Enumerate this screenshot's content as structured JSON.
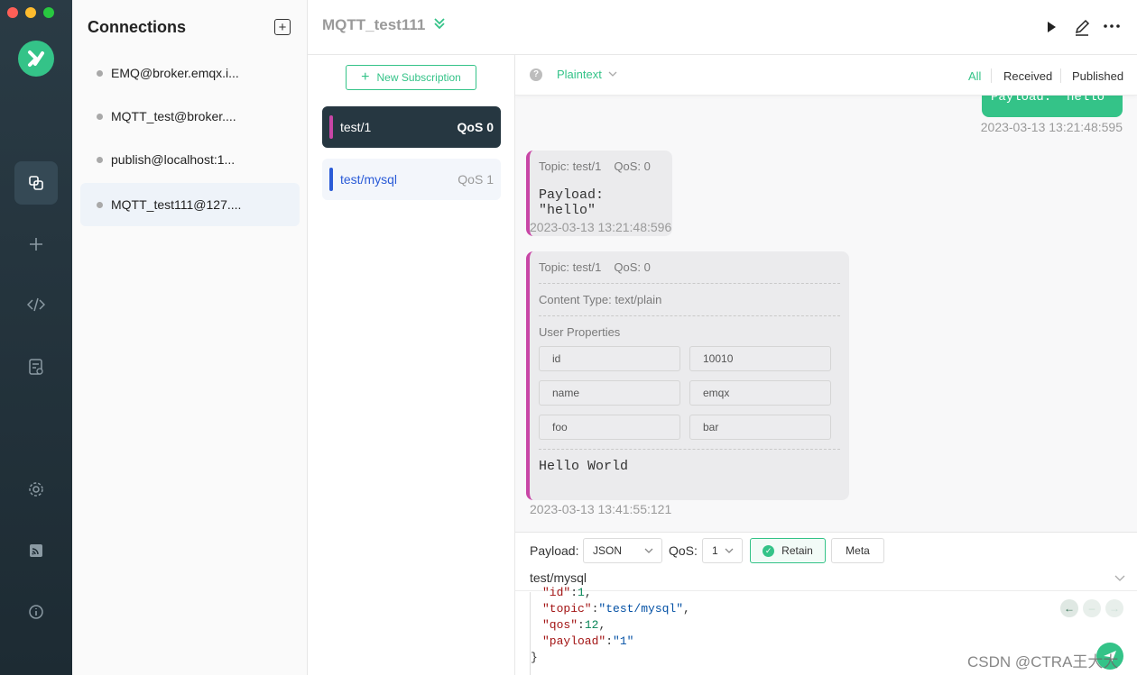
{
  "connections": {
    "title": "Connections",
    "add_icon": "plus-square-icon",
    "items": [
      {
        "label": "EMQ@broker.emqx.i..."
      },
      {
        "label": "MQTT_test@broker...."
      },
      {
        "label": "publish@localhost:1..."
      },
      {
        "label": "MQTT_test111@127...."
      }
    ]
  },
  "rail": {
    "icons": [
      "connections-icon",
      "plus-icon",
      "script-icon",
      "log-icon",
      "settings-icon",
      "rss-icon",
      "info-icon"
    ]
  },
  "header": {
    "title": "MQTT_test111",
    "icons": [
      "double-chevron-down-icon",
      "play-icon",
      "edit-icon",
      "more-icon"
    ]
  },
  "subscriptions": {
    "new_label": "New Subscription",
    "items": [
      {
        "topic": "test/1",
        "qos": "QoS 0",
        "color": "#c846a6"
      },
      {
        "topic": "test/mysql",
        "qos": "QoS 1",
        "color": "#2a5bd7"
      }
    ]
  },
  "filter": {
    "format": "Plaintext",
    "tabs": [
      "All",
      "Received",
      "Published"
    ],
    "active_tab": "All"
  },
  "messages": {
    "published": {
      "payload": "Payload: \"hello\"",
      "time": "2023-03-13 13:21:48:595"
    },
    "received": [
      {
        "topic": "Topic: test/1",
        "qos": "QoS: 0",
        "payload": "Payload: \"hello\"",
        "time": "2023-03-13 13:21:48:596"
      },
      {
        "topic": "Topic: test/1",
        "qos": "QoS: 0",
        "content_type": "Content Type: text/plain",
        "user_props_label": "User Properties",
        "user_props": [
          {
            "key": "id",
            "value": "10010"
          },
          {
            "key": "name",
            "value": "emqx"
          },
          {
            "key": "foo",
            "value": "bar"
          }
        ],
        "payload": "Hello World",
        "time": "2023-03-13 13:41:55:121"
      }
    ]
  },
  "publish": {
    "payload_label": "Payload:",
    "payload_format": "JSON",
    "qos_label": "QoS:",
    "qos_value": "1",
    "retain_label": "Retain",
    "meta_label": "Meta",
    "topic": "test/mysql",
    "editor": {
      "line1_key": "\"id\"",
      "line1_val": "1",
      "line2_key": "\"topic\"",
      "line2_val": "\"test/mysql\"",
      "line3_key": "\"qos\"",
      "line3_val": "12",
      "line4_key": "\"payload\"",
      "line4_val": "\"1\""
    }
  },
  "watermark": "CSDN @CTRA王大大",
  "colors": {
    "accent": "#34c388",
    "sub1": "#c846a6",
    "sub2": "#2a5bd7"
  }
}
